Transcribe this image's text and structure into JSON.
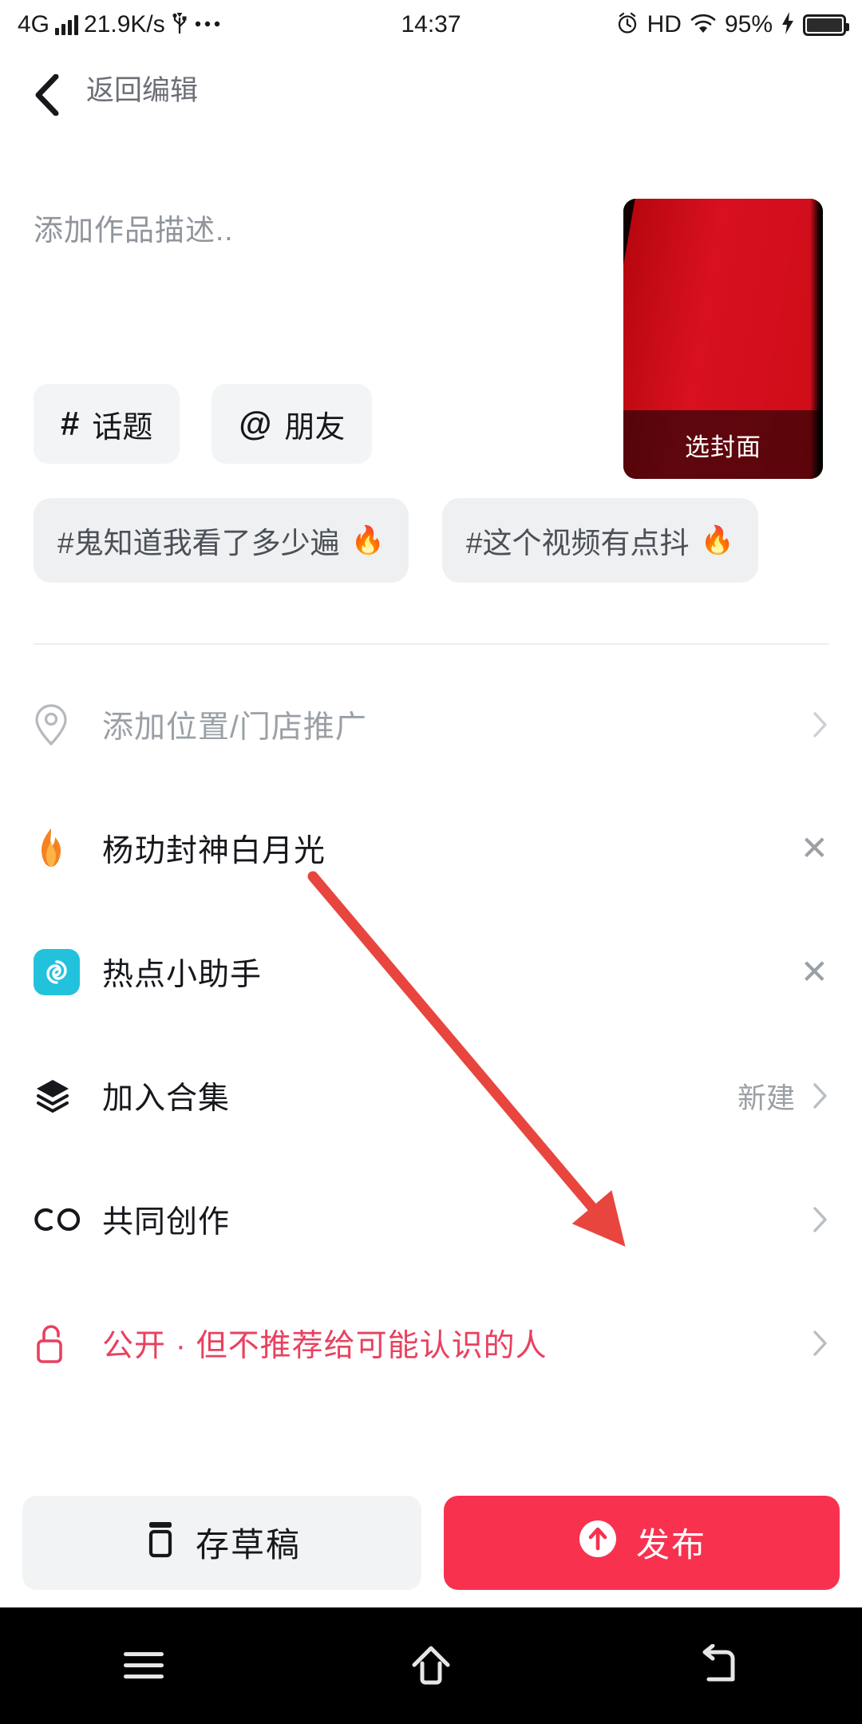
{
  "status_bar": {
    "network_type": "4G",
    "data_rate": "21.9K/s",
    "more_icon": "ellipsis-icon",
    "usb_icon": "usb-icon",
    "time": "14:37",
    "alarm_icon": "alarm-clock-icon",
    "hd_label": "HD",
    "wifi_icon": "wifi-icon",
    "battery_percent": "95%",
    "charging_icon": "lightning-bolt-icon"
  },
  "header": {
    "back_icon": "back-chevron-icon",
    "title": "返回编辑"
  },
  "description": {
    "placeholder": "添加作品描述.."
  },
  "cover": {
    "label": "选封面",
    "primary_color": "#d81020"
  },
  "chips": [
    {
      "symbol": "#",
      "label": "话题",
      "name": "topic-chip"
    },
    {
      "symbol": "@",
      "label": "朋友",
      "name": "friend-chip"
    }
  ],
  "suggested_tags": [
    {
      "text": "#鬼知道我看了多少遍",
      "fire": "🔥"
    },
    {
      "text": "#这个视频有点抖",
      "fire": "🔥"
    }
  ],
  "list": [
    {
      "icon": "location-pin-icon",
      "label": "添加位置/门店推广",
      "style": "muted",
      "right_text": "",
      "trailing": "chevron"
    },
    {
      "icon": "flame-icon",
      "label": "杨玏封神白月光",
      "style": "normal",
      "right_text": "",
      "trailing": "close"
    },
    {
      "icon": "hot-assistant-icon",
      "label": "热点小助手",
      "style": "normal",
      "right_text": "",
      "trailing": "close"
    },
    {
      "icon": "layers-icon",
      "label": "加入合集",
      "style": "normal",
      "right_text": "新建",
      "trailing": "chevron"
    },
    {
      "icon": "co-create-icon",
      "label": "共同创作",
      "style": "normal",
      "right_text": "",
      "trailing": "chevron"
    },
    {
      "icon": "unlock-icon",
      "label": "公开 · 但不推荐给可能认识的人",
      "style": "danger",
      "right_text": "",
      "trailing": "chevron"
    }
  ],
  "bottom": {
    "draft_icon": "draft-box-icon",
    "draft_label": "存草稿",
    "publish_icon": "upload-arrow-icon",
    "publish_label": "发布",
    "publish_color": "#f8314f"
  },
  "nav_bar": {
    "menu_icon": "menu-icon",
    "home_icon": "home-icon",
    "back_icon": "back-arrow-icon"
  },
  "annotation": {
    "arrow_color": "#e8453f",
    "points_to": "发布"
  }
}
